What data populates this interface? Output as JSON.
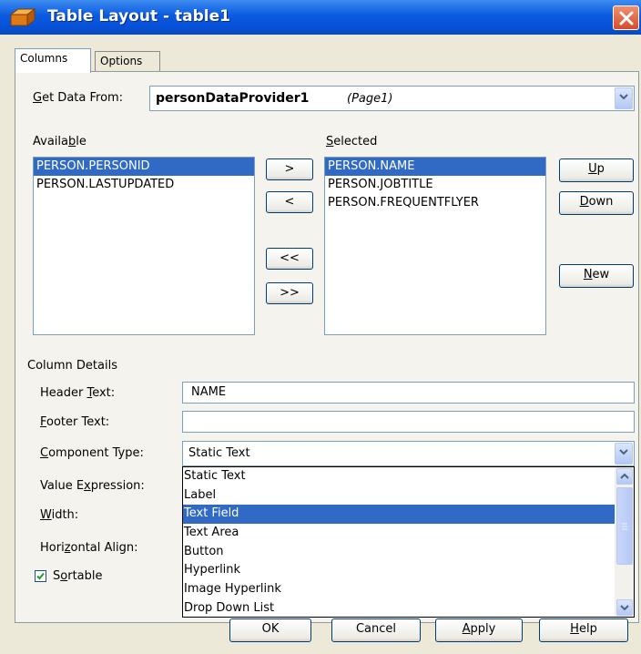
{
  "window": {
    "title": "Table Layout - table1",
    "close_icon": "close-icon"
  },
  "tabs": [
    {
      "label": "Columns",
      "active": true
    },
    {
      "label": "Options",
      "active": false
    }
  ],
  "get_data": {
    "label_prefix": "G",
    "label_rest": "et Data From:",
    "provider": "personDataProvider1",
    "page": "(Page1)"
  },
  "available": {
    "label_pre": "Availa",
    "label_u": "b",
    "label_post": "le",
    "items": [
      "PERSON.PERSONID",
      "PERSON.LASTUPDATED"
    ],
    "selected_index": 0
  },
  "selected": {
    "label_u": "S",
    "label_rest": "elected",
    "items": [
      "PERSON.NAME",
      "PERSON.JOBTITLE",
      "PERSON.FREQUENTFLYER"
    ],
    "selected_index": 0
  },
  "move_buttons": {
    "add": ">",
    "remove": "<",
    "remove_all": "<<",
    "add_all": ">>"
  },
  "order_buttons": {
    "up": {
      "u": "U",
      "rest": "p"
    },
    "down": {
      "u": "D",
      "rest": "own"
    },
    "new": {
      "u": "N",
      "rest": "ew"
    }
  },
  "column_details": {
    "section_label": "Column Details",
    "header_text": {
      "pre": "Header ",
      "u": "T",
      "post": "ext:",
      "value": "NAME"
    },
    "footer_text": {
      "pre": "",
      "u": "F",
      "post": "ooter Text:",
      "value": ""
    },
    "component_type": {
      "pre": "",
      "u": "C",
      "post": "omponent Type:",
      "value": "Static Text"
    },
    "value_expression": {
      "pre": "Value E",
      "u": "x",
      "post": "pression:"
    },
    "width": {
      "pre": "",
      "u": "W",
      "post": "idth:"
    },
    "horizontal_align": {
      "pre": "Hori",
      "u": "z",
      "post": "ontal Align:"
    },
    "sortable": {
      "pre": "S",
      "u": "o",
      "post": "rtable",
      "checked": true
    }
  },
  "dropdown_options": [
    "Static Text",
    "Label",
    "Text Field",
    "Text Area",
    "Button",
    "Hyperlink",
    "Image Hyperlink",
    "Drop Down List"
  ],
  "dropdown_highlight_index": 2,
  "dialog_buttons": {
    "ok": "OK",
    "cancel": "Cancel",
    "apply": {
      "u": "A",
      "rest": "pply"
    },
    "help": {
      "u": "H",
      "rest": "elp"
    }
  },
  "colors": {
    "title_bar": "#0a5ae0",
    "selection": "#316ac5",
    "face": "#ece9d8"
  }
}
